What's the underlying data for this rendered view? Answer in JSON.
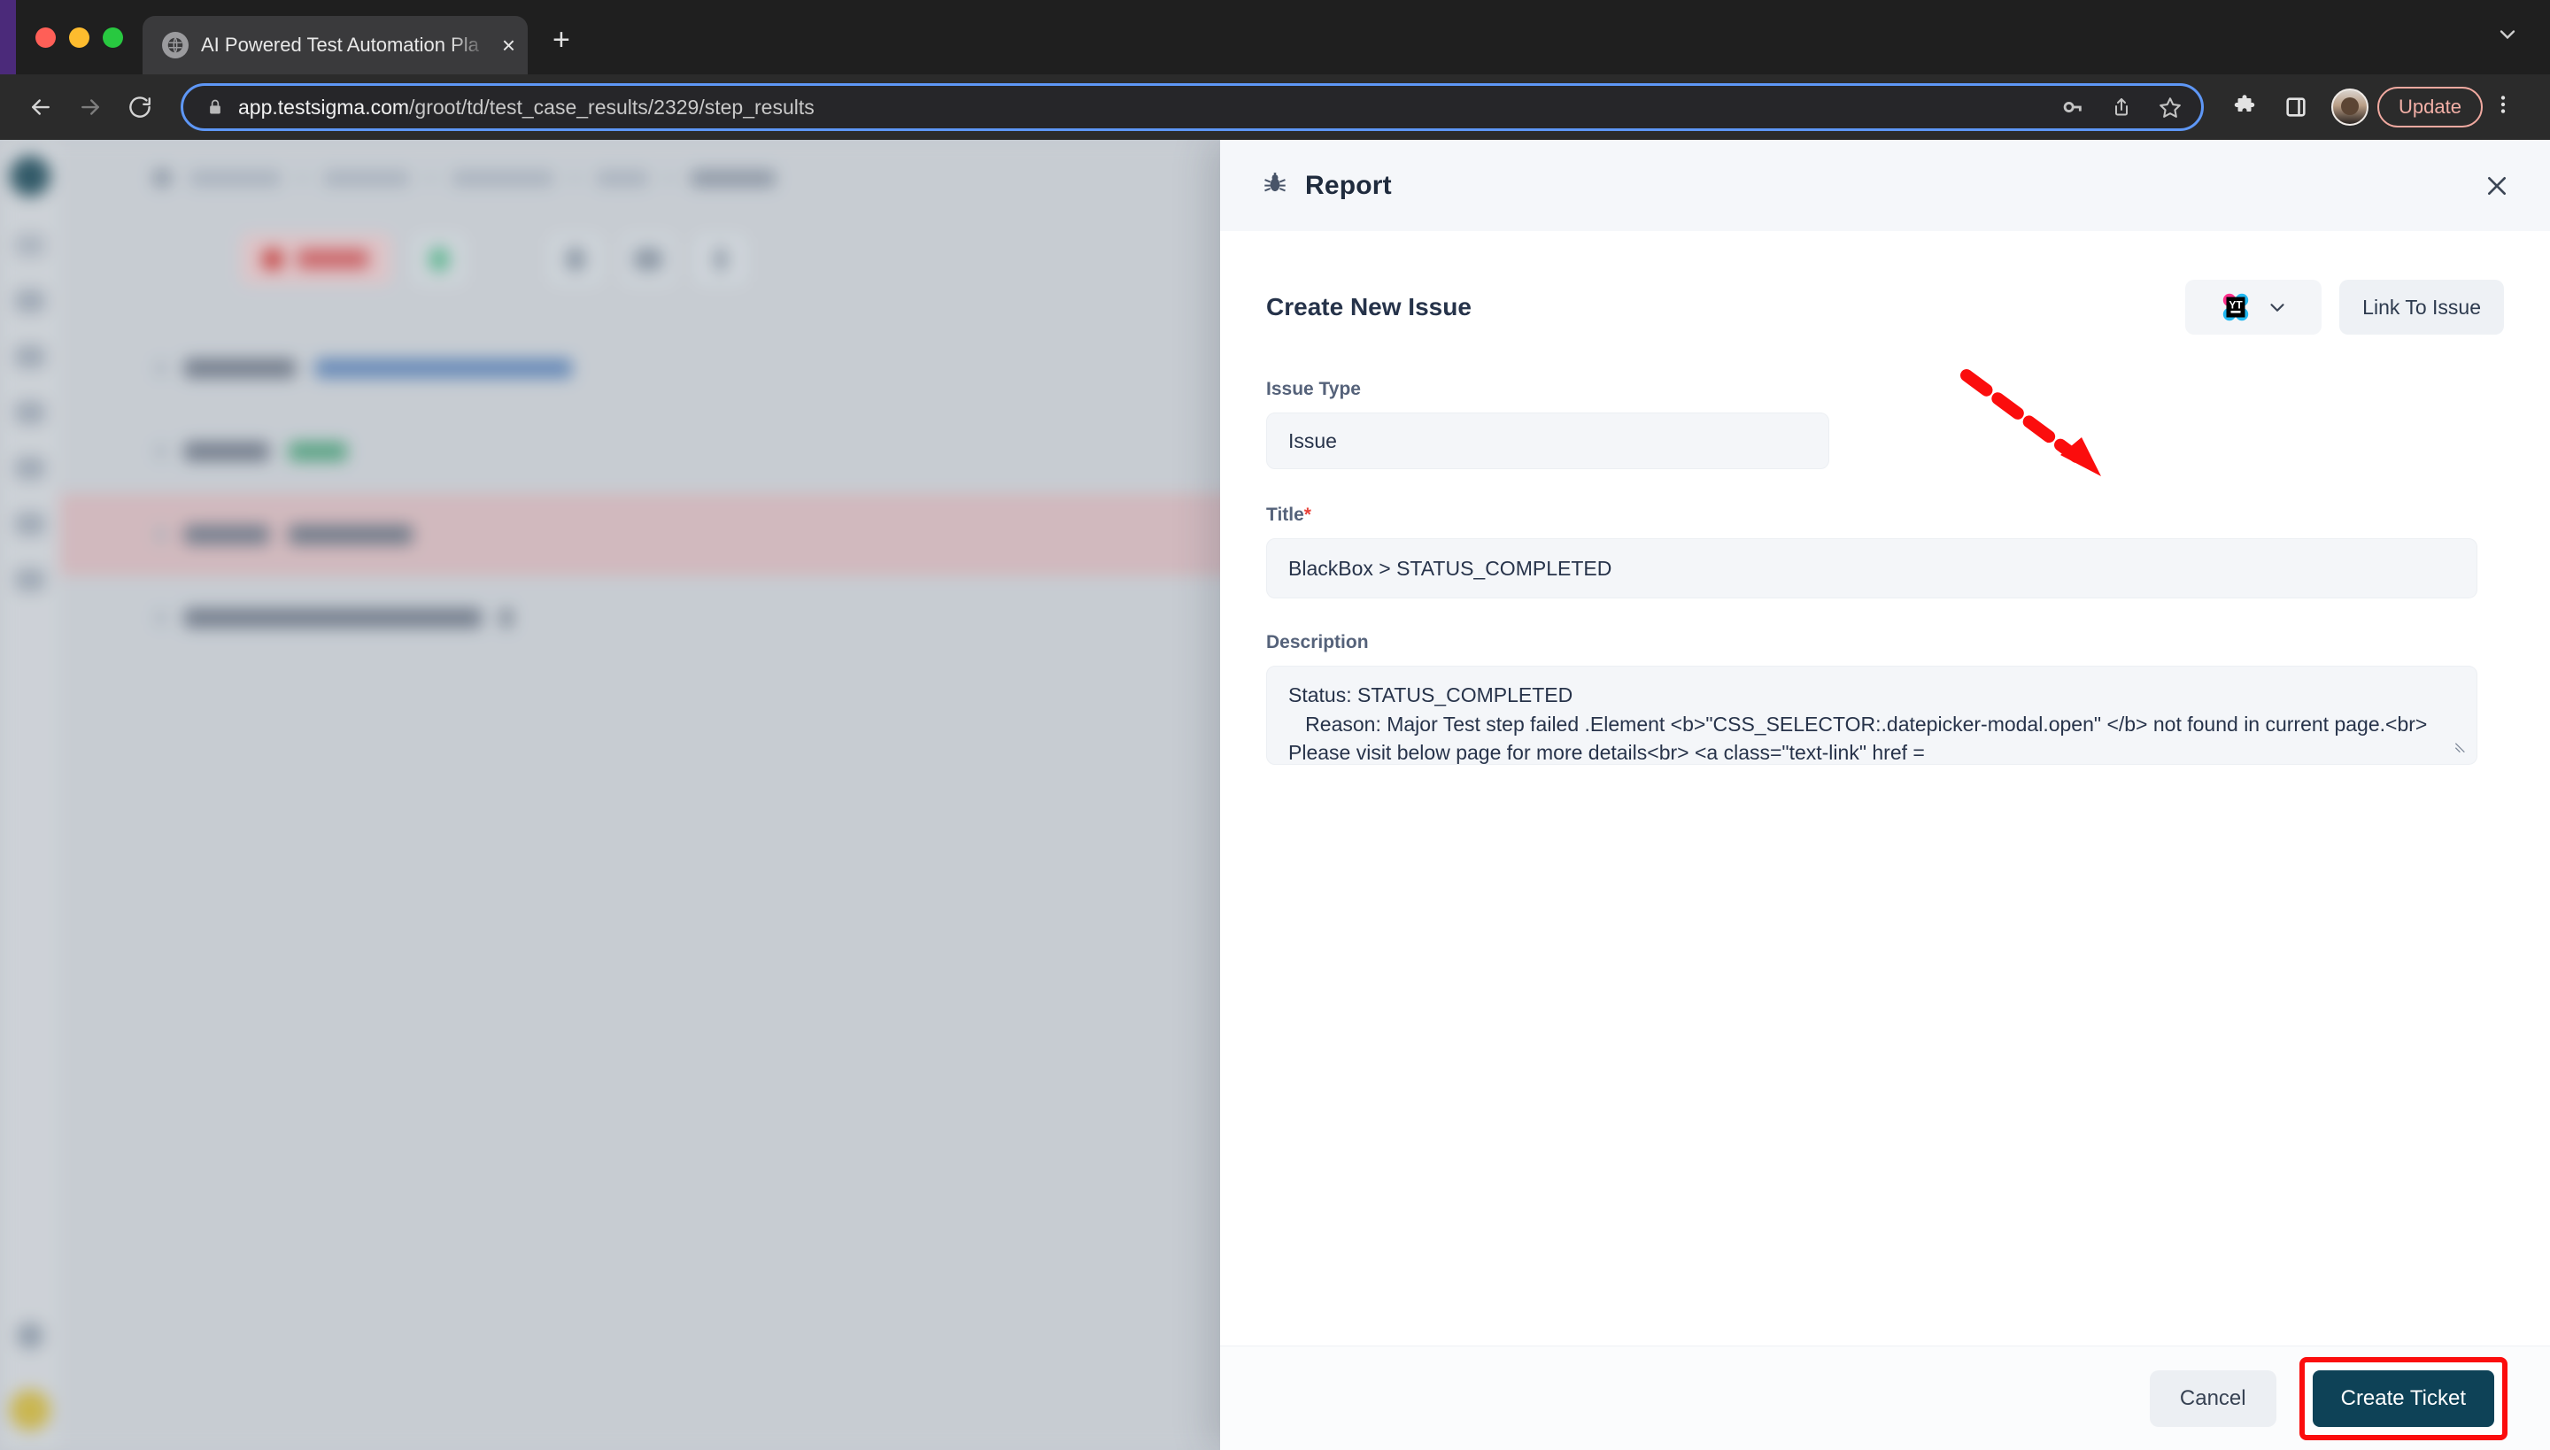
{
  "browser": {
    "tab": {
      "title": "AI Powered Test Automation Pla",
      "favicon": "globe-icon",
      "close": "×"
    },
    "new_tab": "+",
    "url": {
      "host": "app.testsigma.com",
      "path": "/groot/td/test_case_results/2329/step_results"
    },
    "update_label": "Update",
    "icons": {
      "back": "back-arrow-icon",
      "forward": "forward-arrow-icon",
      "reload": "reload-icon",
      "lock": "lock-icon",
      "password": "key-icon",
      "share": "share-icon",
      "bookmark": "star-icon",
      "extensions": "puzzle-icon",
      "sidepanel": "side-panel-icon",
      "profile": "avatar-icon",
      "menu": "kebab-menu-icon"
    }
  },
  "panel": {
    "title": "Report",
    "title_icon": "bug-icon",
    "close_icon": "close-icon",
    "create_new_issue_label": "Create New Issue",
    "tool_select": {
      "value": "YT",
      "icon": "youtrack-logo-icon",
      "chevron": "chevron-down-icon"
    },
    "link_to_issue_label": "Link To Issue",
    "fields": {
      "issue_type": {
        "label": "Issue Type",
        "value": "Issue"
      },
      "title": {
        "label": "Title",
        "required": "*",
        "value": "BlackBox > STATUS_COMPLETED"
      },
      "description": {
        "label": "Description",
        "value": "Status: STATUS_COMPLETED\n   Reason: Major Test step failed .Element <b>\"CSS_SELECTOR:.datepicker-modal.open\" </b> not found in current page.<br> Please visit below page for more details<br> <a class=\"text-link\" href ="
      }
    },
    "footer": {
      "cancel_label": "Cancel",
      "create_ticket_label": "Create Ticket"
    }
  },
  "annotation": {
    "arrow": "red-dashed-arrow",
    "arrow_color": "#fb0d0d",
    "highlight_box_color": "#fb0d0d"
  },
  "colors": {
    "panel_header_bg": "#f5f7fa",
    "field_bg": "#f4f6f9",
    "primary_button_bg": "#0e4257",
    "accent_red": "#fb0d0d",
    "label_text": "#55627a",
    "omnibox_focus": "#5e97f6"
  }
}
